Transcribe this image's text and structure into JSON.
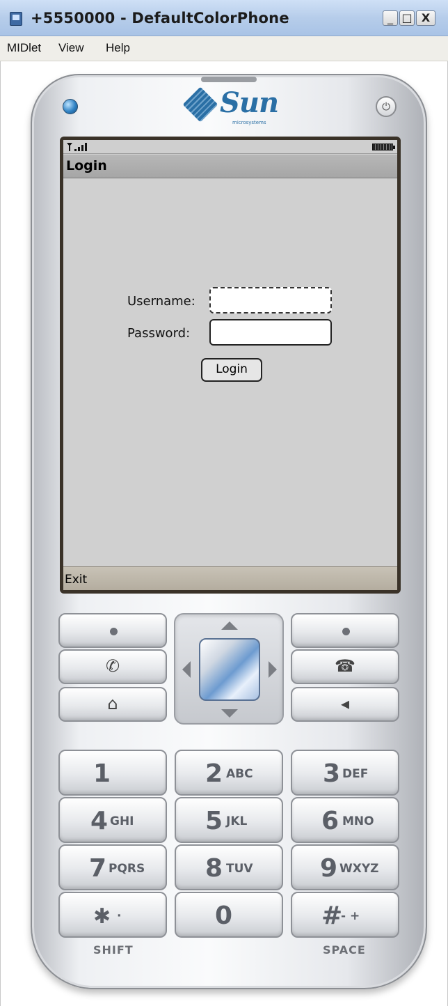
{
  "window": {
    "title": "+5550000 - DefaultColorPhone",
    "min_glyph": "_",
    "max_glyph": "□",
    "close_glyph": "X"
  },
  "menu": [
    "MIDlet",
    "View",
    "Help"
  ],
  "phone": {
    "brand": "Sun",
    "brand_sub": "microsystems",
    "power_glyph": "⏻"
  },
  "screen": {
    "title": "Login",
    "username_label": "Username:",
    "username_value": "",
    "password_label": "Password:",
    "password_value": "",
    "login_button": "Login",
    "softkey_left": "Exit"
  },
  "keypad": {
    "call_glyph": "✆",
    "end_glyph": "☎",
    "home_glyph": "⌂",
    "clear_glyph": "◂",
    "keys": [
      {
        "digit": "1",
        "letters": ""
      },
      {
        "digit": "2",
        "letters": "ABC"
      },
      {
        "digit": "3",
        "letters": "DEF"
      },
      {
        "digit": "4",
        "letters": "GHI"
      },
      {
        "digit": "5",
        "letters": "JKL"
      },
      {
        "digit": "6",
        "letters": "MNO"
      },
      {
        "digit": "7",
        "letters": "PQRS"
      },
      {
        "digit": "8",
        "letters": "TUV"
      },
      {
        "digit": "9",
        "letters": "WXYZ"
      },
      {
        "digit": "✱",
        "letters": "·"
      },
      {
        "digit": "0",
        "letters": ""
      },
      {
        "digit": "#",
        "letters": "- +"
      }
    ],
    "shift_label": "SHIFT",
    "space_label": "SPACE"
  }
}
